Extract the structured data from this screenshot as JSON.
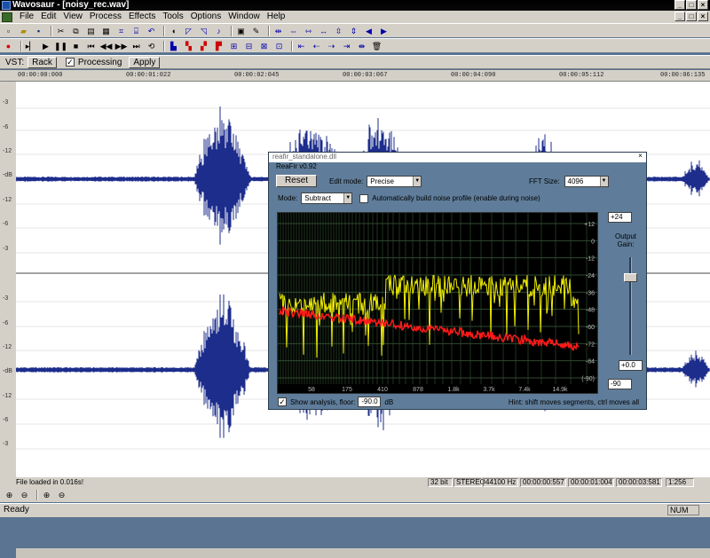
{
  "window": {
    "title": "Wavosaur - [noisy_rec.wav]",
    "controls": [
      "_",
      "□",
      "×"
    ]
  },
  "menu": [
    "File",
    "Edit",
    "View",
    "Process",
    "Effects",
    "Tools",
    "Options",
    "Window",
    "Help"
  ],
  "vst": {
    "label": "VST:",
    "rack": "Rack",
    "processing": "Processing",
    "apply": "Apply"
  },
  "ruler": [
    "00:00:00:000",
    "00:00:01:022",
    "00:00:02:045",
    "00:00:03:067",
    "00:00:04:090",
    "00:00:05:112",
    "00:00:06:135"
  ],
  "db_labels": [
    "-3",
    "-6",
    "-12",
    "-dB",
    "-12",
    "-6",
    "-3",
    "-3",
    "-6",
    "-12",
    "-dB",
    "-12",
    "-6",
    "-3"
  ],
  "status": {
    "loaded": "File loaded in 0.016s!",
    "bits": "32 bit",
    "channels": "STEREO",
    "rate": "44100 Hz",
    "pos1": "00:00:00:557",
    "pos2": "00:00:01:004",
    "pos3": "00:00:03:581",
    "zoom": "1:256",
    "ready": "Ready",
    "num": "NUM"
  },
  "reafir": {
    "title": "reafir_standalone.dll",
    "version": "ReaFir v0.92",
    "reset": "Reset",
    "edit_mode_label": "Edit mode:",
    "edit_mode": "Precise",
    "fft_label": "FFT Size:",
    "fft": "4096",
    "mode_label": "Mode:",
    "mode": "Subtract",
    "auto_label": "Automatically build noise profile (enable during noise)",
    "y_labels": [
      "+12",
      "0",
      "-12",
      "-24",
      "-36",
      "-48",
      "-60",
      "-72",
      "-84",
      "(-90)"
    ],
    "x_labels": [
      "58",
      "175",
      "410",
      "878",
      "1.8k",
      "3.7k",
      "7.4k",
      "14.9k"
    ],
    "gain_top": "+24",
    "output_gain": "Output Gain:",
    "gain_value": "+0.0",
    "gain_bottom": "-90",
    "show_analysis": "Show analysis, floor:",
    "floor": "-90.0",
    "floor_unit": "dB",
    "hint": "Hint: shift moves segments, ctrl moves all"
  }
}
